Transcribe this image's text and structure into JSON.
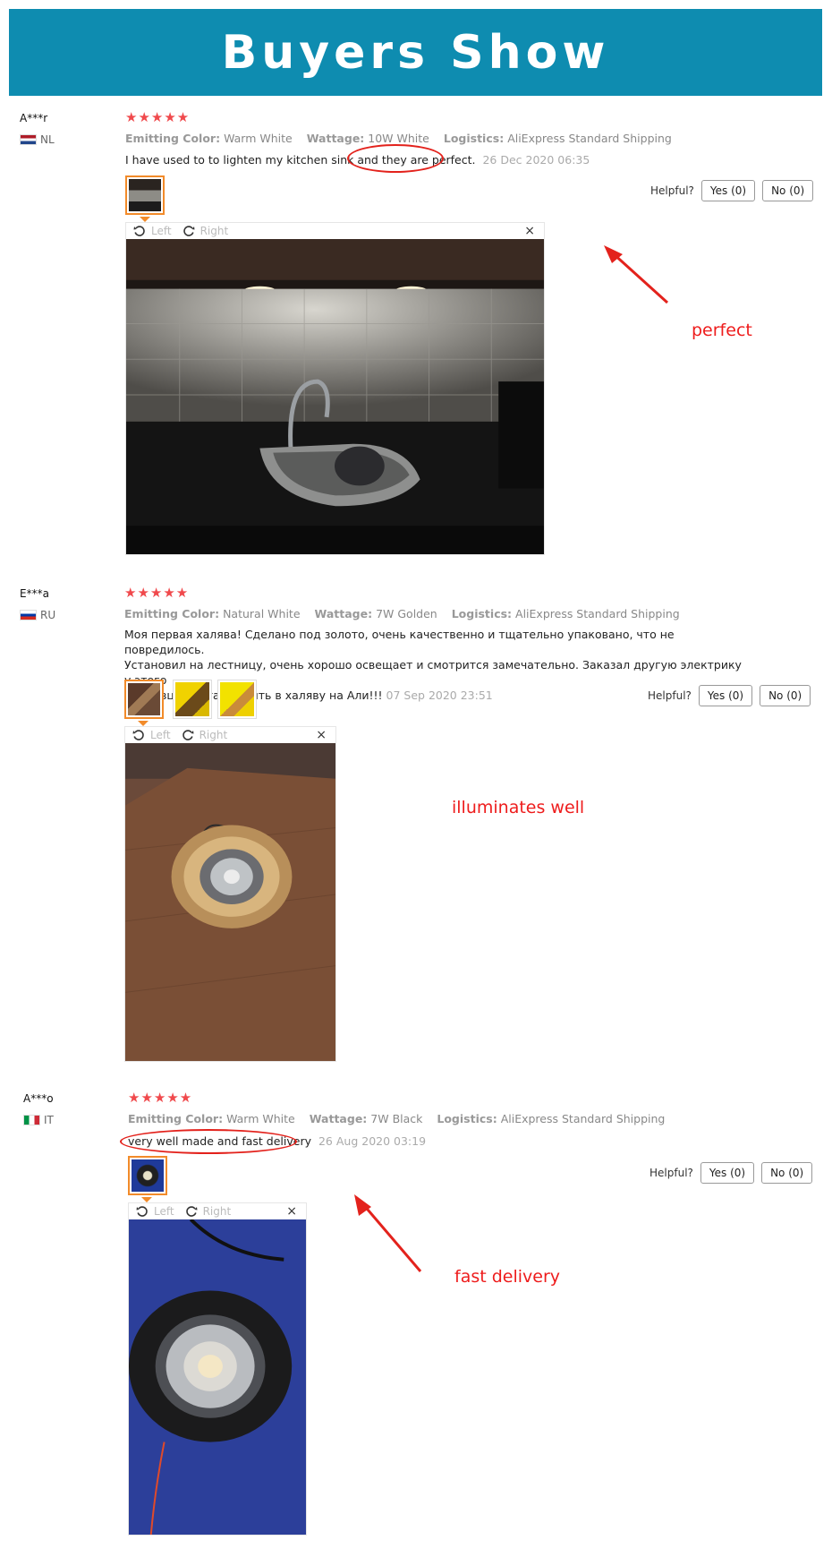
{
  "banner": {
    "title": "Buyers Show"
  },
  "colors": {
    "banner": "#0e8cb0",
    "star": "#f0494c",
    "annotation": "#ee1c1c",
    "thumb_active": "#f28b2a"
  },
  "reviews": [
    {
      "buyer": "A***r",
      "country": "NL",
      "stars": "★★★★★",
      "rating": 5,
      "attr_color_label": "Emitting Color:",
      "attr_color_value": "Warm White",
      "attr_watt_label": "Wattage:",
      "attr_watt_value": "10W White",
      "attr_log_label": "Logistics:",
      "attr_log_value": "AliExpress Standard Shipping",
      "feedback": "I have used to to lighten my kitchen sink and they are perfect.",
      "date": "26 Dec 2020 06:35",
      "helpful": "Helpful?",
      "yes": "Yes (0)",
      "no": "No (0)",
      "viewer": {
        "left": "Left",
        "right": "Right",
        "close": "×"
      },
      "annotation": "perfect"
    },
    {
      "buyer": "E***a",
      "country": "RU",
      "stars": "★★★★★",
      "rating": 5,
      "attr_color_label": "Emitting Color:",
      "attr_color_value": "Natural White",
      "attr_watt_label": "Wattage:",
      "attr_watt_value": "7W Golden",
      "attr_log_label": "Logistics:",
      "attr_log_value": "AliExpress Standard Shipping",
      "feedback_lines": [
        "Моя первая халява! Сделано под золото, очень качественно и тщательно упаковано, что не повредилось.",
        "Установил на лестницу, очень хорошо освещает и смотрится замечательно. Заказал другую электрику у этого",
        "продавца. И стал верить в халяву на Али!!!"
      ],
      "date": "07 Sep 2020 23:51",
      "helpful": "Helpful?",
      "yes": "Yes (0)",
      "no": "No (0)",
      "viewer": {
        "left": "Left",
        "right": "Right",
        "close": "×"
      },
      "annotation": "illuminates well"
    },
    {
      "buyer": "A***o",
      "country": "IT",
      "stars": "★★★★★",
      "rating": 5,
      "attr_color_label": "Emitting Color:",
      "attr_color_value": "Warm White",
      "attr_watt_label": "Wattage:",
      "attr_watt_value": "7W Black",
      "attr_log_label": "Logistics:",
      "attr_log_value": "AliExpress Standard Shipping",
      "feedback": "very well made and fast delivery",
      "date": "26 Aug 2020 03:19",
      "helpful": "Helpful?",
      "yes": "Yes (0)",
      "no": "No (0)",
      "viewer": {
        "left": "Left",
        "right": "Right",
        "close": "×"
      },
      "annotation": "fast delivery"
    }
  ]
}
